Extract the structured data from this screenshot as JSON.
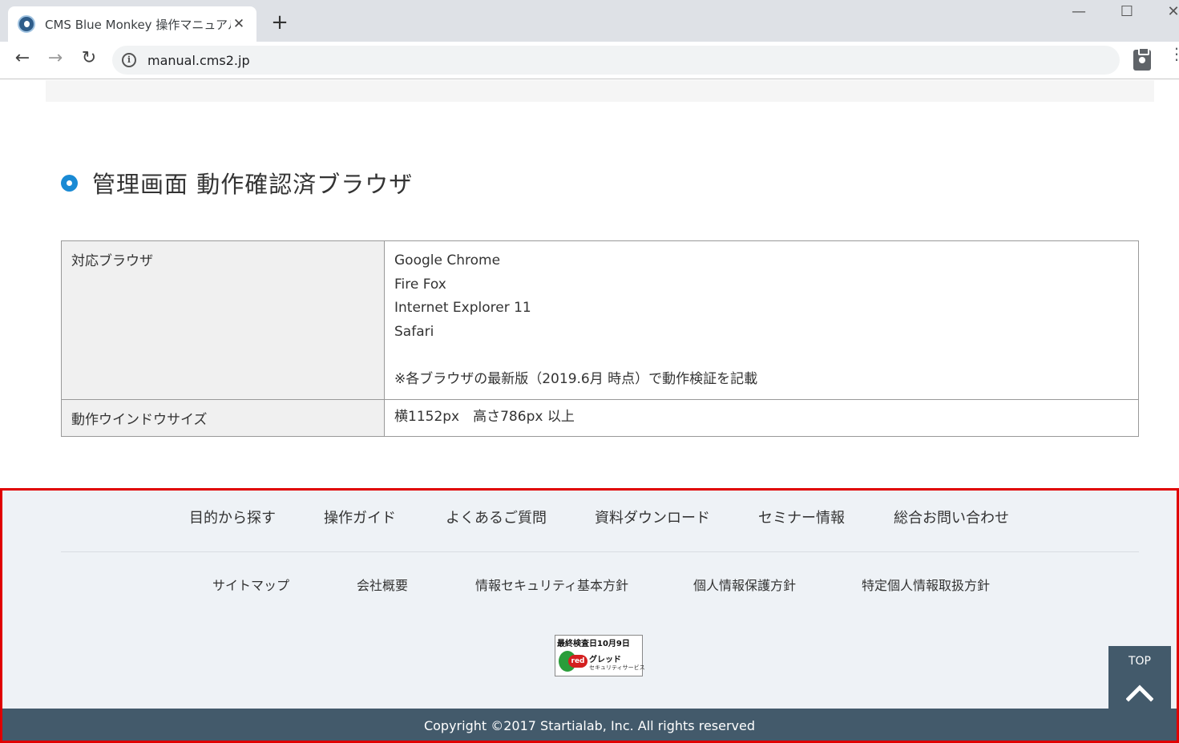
{
  "browser": {
    "tab_title": "CMS Blue Monkey 操作マニュアル",
    "tab_close": "✕",
    "new_tab": "+",
    "url": "manual.cms2.jp",
    "window_min": "—",
    "window_max": "☐",
    "window_close": "✕",
    "back": "←",
    "forward": "→",
    "reload": "↻",
    "info": "i",
    "menu": "⋮"
  },
  "section": {
    "heading": "管理画面 動作確認済ブラウザ"
  },
  "table": {
    "row1_label": "対応ブラウザ",
    "browsers": [
      "Google Chrome",
      "Fire Fox",
      "Internet Explorer 11",
      "Safari"
    ],
    "note": "※各ブラウザの最新版（2019.6月 時点）で動作検証を記載",
    "row2_label": "動作ウインドウサイズ",
    "row2_value": "横1152px　高さ786px 以上"
  },
  "footer": {
    "nav_primary": [
      "目的から探す",
      "操作ガイド",
      "よくあるご質問",
      "資料ダウンロード",
      "セミナー情報",
      "総合お問い合わせ"
    ],
    "nav_secondary": [
      "サイトマップ",
      "会社概要",
      "情報セキュリティ基本方針",
      "個人情報保護方針",
      "特定個人情報取扱方針"
    ],
    "badge": {
      "date": "最終検査日10月9日",
      "logo_text": "red",
      "name": "グレッド",
      "sub": "セキュリティサービス"
    },
    "top_label": "TOP",
    "copyright": "Copyright ©2017 Startialab, Inc. All rights reserved"
  },
  "colors": {
    "accent": "#1a8ad4",
    "footer_bg": "#eef2f6",
    "footer_bar": "#435a6b",
    "highlight_border": "#e00000"
  }
}
